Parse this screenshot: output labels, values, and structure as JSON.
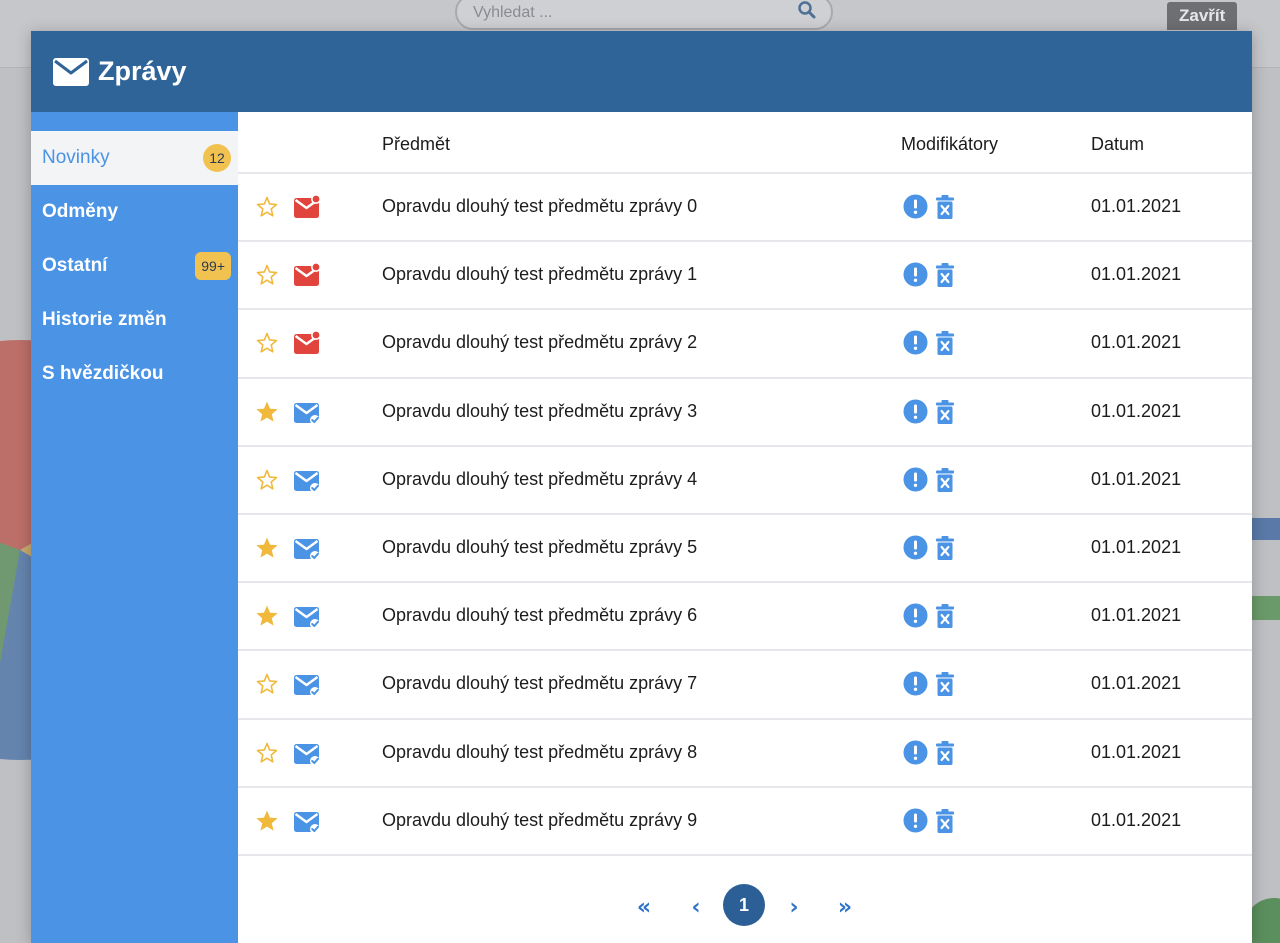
{
  "background": {
    "search_placeholder": "Vyhledat ...",
    "close_label": "Zavřít"
  },
  "modal": {
    "title": "Zprávy",
    "colors": {
      "header": "#2f6499",
      "sidebar": "#4a93e5",
      "star": "#f0b93c",
      "unread_mail": "#e0443c",
      "read_mail": "#4a93e5",
      "badge": "#f1c24f"
    }
  },
  "sidebar": {
    "items": [
      {
        "label": "Novinky",
        "badge": "12",
        "active": true
      },
      {
        "label": "Odměny",
        "badge": ""
      },
      {
        "label": "Ostatní",
        "badge": "99+"
      },
      {
        "label": "Historie změn",
        "badge": ""
      },
      {
        "label": "S hvězdičkou",
        "badge": ""
      }
    ]
  },
  "table": {
    "headers": {
      "icons": "",
      "subject": "Předmět",
      "modifiers": "Modifikátory",
      "date": "Datum"
    },
    "rows": [
      {
        "starred": false,
        "unread": true,
        "subject": "Opravdu dlouhý test předmětu zprávy 0",
        "date": "01.01.2021"
      },
      {
        "starred": false,
        "unread": true,
        "subject": "Opravdu dlouhý test předmětu zprávy 1",
        "date": "01.01.2021"
      },
      {
        "starred": false,
        "unread": true,
        "subject": "Opravdu dlouhý test předmětu zprávy 2",
        "date": "01.01.2021"
      },
      {
        "starred": true,
        "unread": false,
        "subject": "Opravdu dlouhý test předmětu zprávy 3",
        "date": "01.01.2021"
      },
      {
        "starred": false,
        "unread": false,
        "subject": "Opravdu dlouhý test předmětu zprávy 4",
        "date": "01.01.2021"
      },
      {
        "starred": true,
        "unread": false,
        "subject": "Opravdu dlouhý test předmětu zprávy 5",
        "date": "01.01.2021"
      },
      {
        "starred": true,
        "unread": false,
        "subject": "Opravdu dlouhý test předmětu zprávy 6",
        "date": "01.01.2021"
      },
      {
        "starred": false,
        "unread": false,
        "subject": "Opravdu dlouhý test předmětu zprávy 7",
        "date": "01.01.2021"
      },
      {
        "starred": false,
        "unread": false,
        "subject": "Opravdu dlouhý test předmětu zprávy 8",
        "date": "01.01.2021"
      },
      {
        "starred": true,
        "unread": false,
        "subject": "Opravdu dlouhý test předmětu zprávy 9",
        "date": "01.01.2021"
      }
    ]
  },
  "pagination": {
    "first": "«",
    "prev": "‹",
    "current": "1",
    "next": "›",
    "last": "»"
  }
}
